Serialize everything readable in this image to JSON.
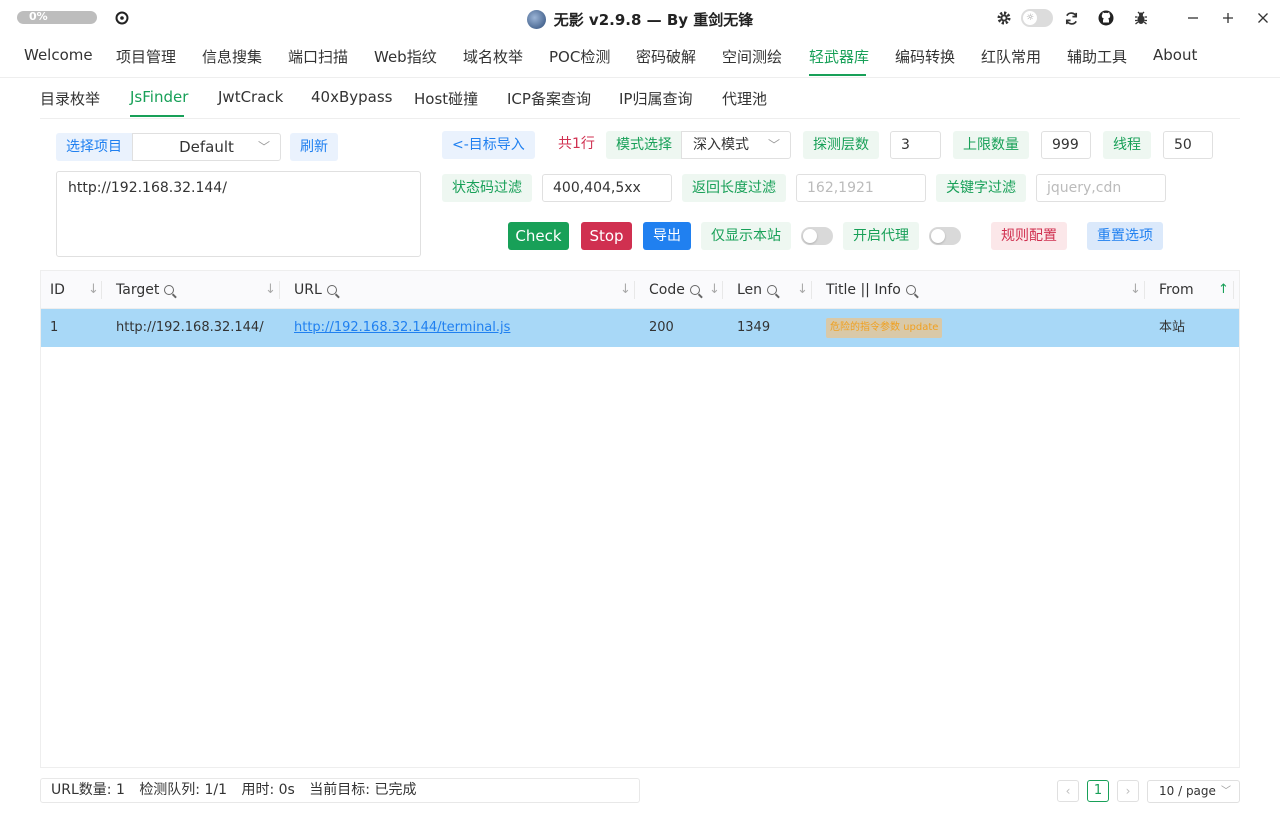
{
  "titlebar": {
    "progress_text": "0%",
    "progress_fraction": 0,
    "title": "无影 v2.9.8 — By 重剑无锋",
    "icons": [
      "reload-icon",
      "gear-icon",
      "theme-toggle",
      "refresh-icon",
      "github-icon",
      "bug-icon",
      "minimize-icon",
      "maximize-icon",
      "close-icon"
    ]
  },
  "mainnav": {
    "items": [
      "Welcome",
      "项目管理",
      "信息搜集",
      "端口扫描",
      "Web指纹",
      "域名枚举",
      "POC检测",
      "密码破解",
      "空间测绘",
      "轻武器库",
      "编码转换",
      "红队常用",
      "辅助工具",
      "About"
    ],
    "active": "轻武器库"
  },
  "subnav": {
    "items": [
      "目录枚举",
      "JsFinder",
      "JwtCrack",
      "40xBypass",
      "Host碰撞",
      "ICP备案查询",
      "IP归属查询",
      "代理池"
    ],
    "active": "JsFinder"
  },
  "form": {
    "select_project_label": "选择项目",
    "project_value": "Default",
    "refresh_label": "刷新",
    "target_text": "http://192.168.32.144/",
    "import_label": "<-目标导入",
    "count_text": "共1行",
    "mode_label": "模式选择",
    "mode_value": "深入模式",
    "depth_label": "探测层数",
    "depth_value": "3",
    "limit_label": "上限数量",
    "limit_value": "999",
    "threads_label": "线程",
    "threads_value": "50",
    "status_filter_label": "状态码过滤",
    "status_filter_value": "400,404,5xx",
    "length_filter_label": "返回长度过滤",
    "length_filter_placeholder": "162,1921",
    "keyword_filter_label": "关键字过滤",
    "keyword_filter_placeholder": "jquery,cdn",
    "check_label": "Check",
    "stop_label": "Stop",
    "export_label": "导出",
    "only_site_label": "仅显示本站",
    "proxy_label": "开启代理",
    "rules_label": "规则配置",
    "reset_label": "重置选项"
  },
  "colors": {
    "accent": "#18a058",
    "check": "#18a058",
    "stop": "#d03050",
    "export": "#2080f0",
    "row_highlight": "#a8d8f7"
  },
  "table": {
    "headers": [
      "ID",
      "Target",
      "URL",
      "Code",
      "Len",
      "Title || Info",
      "From"
    ],
    "rows": [
      {
        "id": "1",
        "target": "http://192.168.32.144/",
        "url": "http://192.168.32.144/terminal.js",
        "code": "200",
        "len": "1349",
        "info": "危险的指令参数 update",
        "from": "本站"
      }
    ]
  },
  "footer": {
    "url_count": "URL数量: 1",
    "queue": "检测队列: 1/1",
    "elapsed": "用时: 0s",
    "current_target": "当前目标: 已完成",
    "current_page": "1",
    "page_size": "10 / page"
  }
}
